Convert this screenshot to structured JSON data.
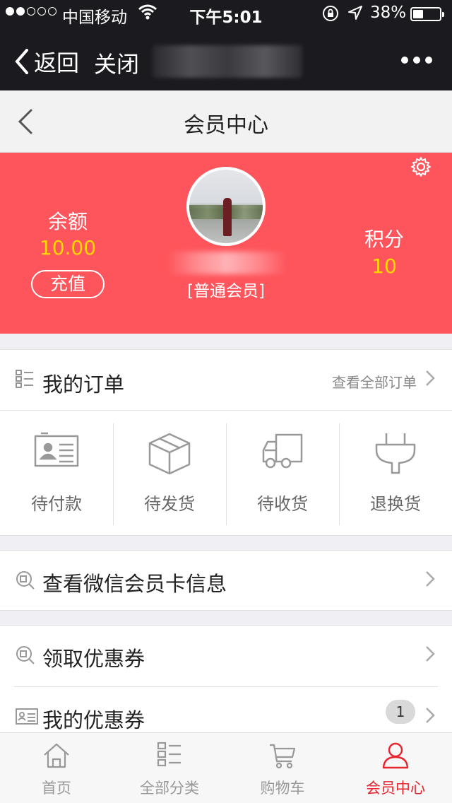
{
  "status_bar": {
    "carrier": "中国移动",
    "time": "下午5:01",
    "battery": "38%",
    "battery_level": 0.38
  },
  "wechat_nav": {
    "back": "返回",
    "close": "关闭"
  },
  "header": {
    "title": "会员中心"
  },
  "profile": {
    "balance_label": "余额",
    "balance_value": "10.00",
    "recharge_label": "充值",
    "level": "[普通会员]",
    "points_label": "积分",
    "points_value": "10"
  },
  "orders": {
    "title": "我的订单",
    "view_all": "查看全部订单",
    "statuses": [
      {
        "label": "待付款",
        "icon": "id-card-icon"
      },
      {
        "label": "待发货",
        "icon": "box-icon"
      },
      {
        "label": "待收货",
        "icon": "truck-icon"
      },
      {
        "label": "退换货",
        "icon": "plug-icon"
      }
    ]
  },
  "menu": {
    "wechat_card": "查看微信会员卡信息",
    "get_coupons": "领取优惠券",
    "my_coupons": "我的优惠券",
    "my_coupons_count": "1"
  },
  "tabbar": [
    {
      "label": "首页",
      "icon": "home-icon",
      "active": false
    },
    {
      "label": "全部分类",
      "icon": "category-icon",
      "active": false
    },
    {
      "label": "购物车",
      "icon": "cart-icon",
      "active": false
    },
    {
      "label": "会员中心",
      "icon": "user-icon",
      "active": true
    }
  ],
  "colors": {
    "accent": "#fe545b",
    "highlight": "#ffd800",
    "active_tab": "#e8262f"
  }
}
